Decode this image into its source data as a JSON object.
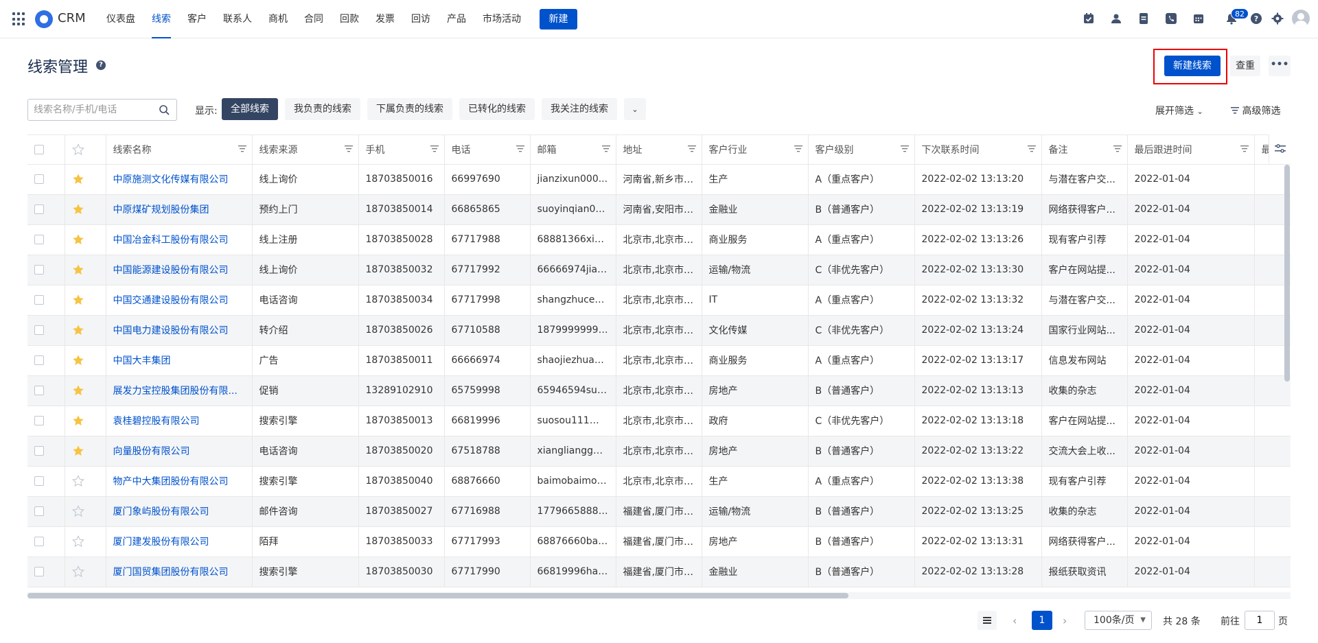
{
  "nav": {
    "brand": "CRM",
    "items": [
      {
        "label": "仪表盘",
        "active": false
      },
      {
        "label": "线索",
        "active": true
      },
      {
        "label": "客户",
        "active": false
      },
      {
        "label": "联系人",
        "active": false
      },
      {
        "label": "商机",
        "active": false
      },
      {
        "label": "合同",
        "active": false
      },
      {
        "label": "回款",
        "active": false
      },
      {
        "label": "发票",
        "active": false
      },
      {
        "label": "回访",
        "active": false
      },
      {
        "label": "产品",
        "active": false
      },
      {
        "label": "市场活动",
        "active": false
      }
    ],
    "new_label": "新建",
    "notification_count": "82",
    "accent": "#0052cc"
  },
  "header": {
    "title": "线索管理",
    "new_lead_label": "新建线索",
    "dedupe_label": "查重",
    "more_label": "•••"
  },
  "filters": {
    "search_placeholder": "线索名称/手机/电话",
    "show_label": "显示:",
    "chips": [
      "全部线索",
      "我负责的线索",
      "下属负责的线索",
      "已转化的线索",
      "我关注的线索"
    ],
    "active_chip": 0,
    "expand_label": "展开筛选",
    "advanced_label": "高级筛选"
  },
  "table": {
    "columns": [
      "线索名称",
      "线索来源",
      "手机",
      "电话",
      "邮箱",
      "地址",
      "客户行业",
      "客户级别",
      "下次联系时间",
      "备注",
      "最后跟进时间",
      "最"
    ],
    "rows": [
      {
        "starred": true,
        "cells": [
          "中原施测文化传媒有限公司",
          "线上询价",
          "18703850016",
          "66997690",
          "jianzixun000...",
          "河南省,新乡市,...",
          "生产",
          "A（重点客户）",
          "2022-02-02 13:13:20",
          "与潜在客户交...",
          "2022-01-04"
        ]
      },
      {
        "starred": true,
        "cells": [
          "中原煤矿规划股份集团",
          "预约上门",
          "18703850014",
          "66865865",
          "suoyinqian000...",
          "河南省,安阳市,...",
          "金融业",
          "B（普通客户）",
          "2022-02-02 13:13:19",
          "网络获得客户...",
          "2022-01-04"
        ]
      },
      {
        "starred": true,
        "cells": [
          "中国冶金科工股份有限公司",
          "线上注册",
          "18703850028",
          "67717988",
          "68881366xian...",
          "北京市,北京市,...",
          "商业服务",
          "A（重点客户）",
          "2022-02-02 13:13:26",
          "现有客户引荐",
          "2022-01-04"
        ]
      },
      {
        "starred": true,
        "cells": [
          "中国能源建设股份有限公司",
          "线上询价",
          "18703850032",
          "67717992",
          "66666974jian...",
          "北京市,北京市,...",
          "运输/物流",
          "C（非优先客户）",
          "2022-02-02 13:13:30",
          "客户在网站提...",
          "2022-01-04"
        ]
      },
      {
        "starred": true,
        "cells": [
          "中国交通建设股份有限公司",
          "电话咨询",
          "18703850034",
          "67717998",
          "shangzhuce00...",
          "北京市,北京市,...",
          "IT",
          "A（重点客户）",
          "2022-02-02 13:13:32",
          "与潜在客户交...",
          "2022-01-04"
        ]
      },
      {
        "starred": true,
        "cells": [
          "中国电力建设股份有限公司",
          "转介绍",
          "18703850026",
          "67710588",
          "18799999999z...",
          "北京市,北京市,...",
          "文化传媒",
          "C（非优先客户）",
          "2022-02-02 13:13:24",
          "国家行业网站...",
          "2022-01-04"
        ]
      },
      {
        "starred": true,
        "cells": [
          "中国大丰集团",
          "广告",
          "18703850011",
          "66666974",
          "shaojiezhuan0...",
          "北京市,北京市,...",
          "商业服务",
          "A（重点客户）",
          "2022-02-02 13:13:17",
          "信息发布网站",
          "2022-01-04"
        ]
      },
      {
        "starred": true,
        "cells": [
          "展发力宝控股集团股份有限...",
          "促销",
          "13289102910",
          "65759998",
          "65946594suni...",
          "北京市,北京市,...",
          "房地产",
          "B（普通客户）",
          "2022-02-02 13:13:13",
          "收集的杂志",
          "2022-01-04"
        ]
      },
      {
        "starred": true,
        "cells": [
          "袁桂碧控股有限公司",
          "搜索引擎",
          "18703850013",
          "66819996",
          "suosou111@g...",
          "北京市,北京市,...",
          "政府",
          "C（非优先客户）",
          "2022-02-02 13:13:18",
          "客户在网站提...",
          "2022-01-04"
        ]
      },
      {
        "starred": true,
        "cells": [
          "向量股份有限公司",
          "电话咨询",
          "18703850020",
          "67518788",
          "xianglianggu f...",
          "北京市,北京市,...",
          "房地产",
          "B（普通客户）",
          "2022-02-02 13:13:22",
          "交流大会上收...",
          "2022-01-04"
        ]
      },
      {
        "starred": false,
        "cells": [
          "物产中大集团股份有限公司",
          "搜索引擎",
          "18703850040",
          "68876660",
          "baimobaimo0...",
          "北京市,北京市,...",
          "生产",
          "A（重点客户）",
          "2022-02-02 13:13:38",
          "现有客户引荐",
          "2022-01-04"
        ]
      },
      {
        "starred": false,
        "cells": [
          "厦门象屿股份有限公司",
          "邮件咨询",
          "18703850027",
          "67716988",
          "17796658888d...",
          "福建省,厦门市,...",
          "运输/物流",
          "B（普通客户）",
          "2022-02-02 13:13:25",
          "收集的杂志",
          "2022-01-04"
        ]
      },
      {
        "starred": false,
        "cells": [
          "厦门建发股份有限公司",
          "陌拜",
          "18703850033",
          "67717993",
          "68876660baol...",
          "福建省,厦门市,...",
          "房地产",
          "B（普通客户）",
          "2022-02-02 13:13:31",
          "网络获得客户...",
          "2022-01-04"
        ]
      },
      {
        "starred": false,
        "cells": [
          "厦门国贸集团股份有限公司",
          "搜索引擎",
          "18703850030",
          "67717990",
          "66819996hang...",
          "福建省,厦门市,...",
          "金融业",
          "B（普通客户）",
          "2022-02-02 13:13:28",
          "报纸获取资讯",
          "2022-01-04"
        ]
      }
    ]
  },
  "pagination": {
    "current_page": "1",
    "page_size": "100条/页",
    "total": "共 28 条",
    "goto_label": "前往",
    "goto_value": "1",
    "page_suffix": "页"
  }
}
